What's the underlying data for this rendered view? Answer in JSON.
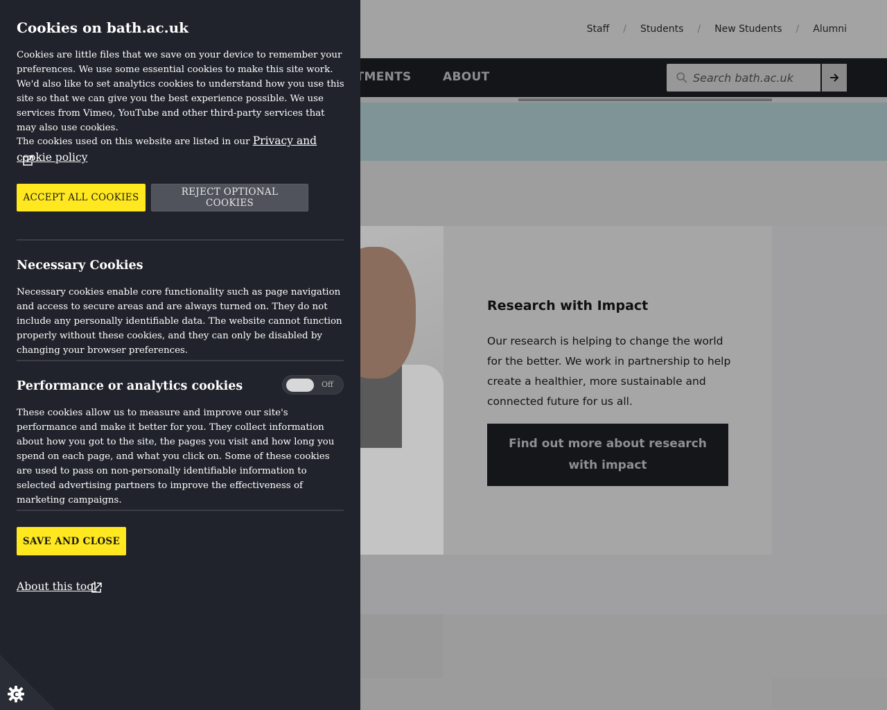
{
  "utility_nav": {
    "links": [
      "Staff",
      "Students",
      "New Students",
      "Alumni"
    ],
    "separator": "/"
  },
  "main_nav": {
    "items": [
      "DEPARTMENTS",
      "ABOUT"
    ]
  },
  "search": {
    "placeholder": "Search bath.ac.uk",
    "submit_icon": "arrow-right-icon"
  },
  "feature": {
    "title": "Research with Impact",
    "text": "Our research is helping to change the world for the better. We work in partnership to help create a healthier, more sustainable and connected future for us all.",
    "button_label": "Find out more about research with impact"
  },
  "cookie_panel": {
    "title": "Cookies on bath.ac.uk",
    "intro": "Cookies are little files that we save on your device to remember your preferences. We use some essential cookies to make this site work. We'd also like to set analytics cookies to understand how you use this site so that we can give you the best experience possible. We use services from Vimeo, YouTube and other third-party services that may also use cookies.",
    "policy_prefix": "The cookies used on this website are listed in our ",
    "policy_link": "Privacy and cookie policy",
    "accept_label": "ACCEPT ALL COOKIES",
    "reject_label": "REJECT OPTIONAL COOKIES",
    "necessary": {
      "title": "Necessary Cookies",
      "text": "Necessary cookies enable core functionality such as page navigation and access to secure areas and are always turned on. They do not include any personally identifiable data. The website cannot function properly without these cookies, and they can only be disabled by changing your browser preferences."
    },
    "performance": {
      "title": "Performance or analytics cookies",
      "toggle_state": "Off",
      "text": "These cookies allow us to measure and improve our site's performance and make it better for you. They collect information about how you got to the site, the pages you visit and how long you spend on each page, and what you click on. Some of these cookies are used to pass on non-personally identifiable information to selected advertising partners to improve the effectiveness of marketing campaigns."
    },
    "save_label": "SAVE AND CLOSE",
    "about_label": "About this tool",
    "accent_color": "#ffe81f",
    "panel_color": "#20232b"
  }
}
